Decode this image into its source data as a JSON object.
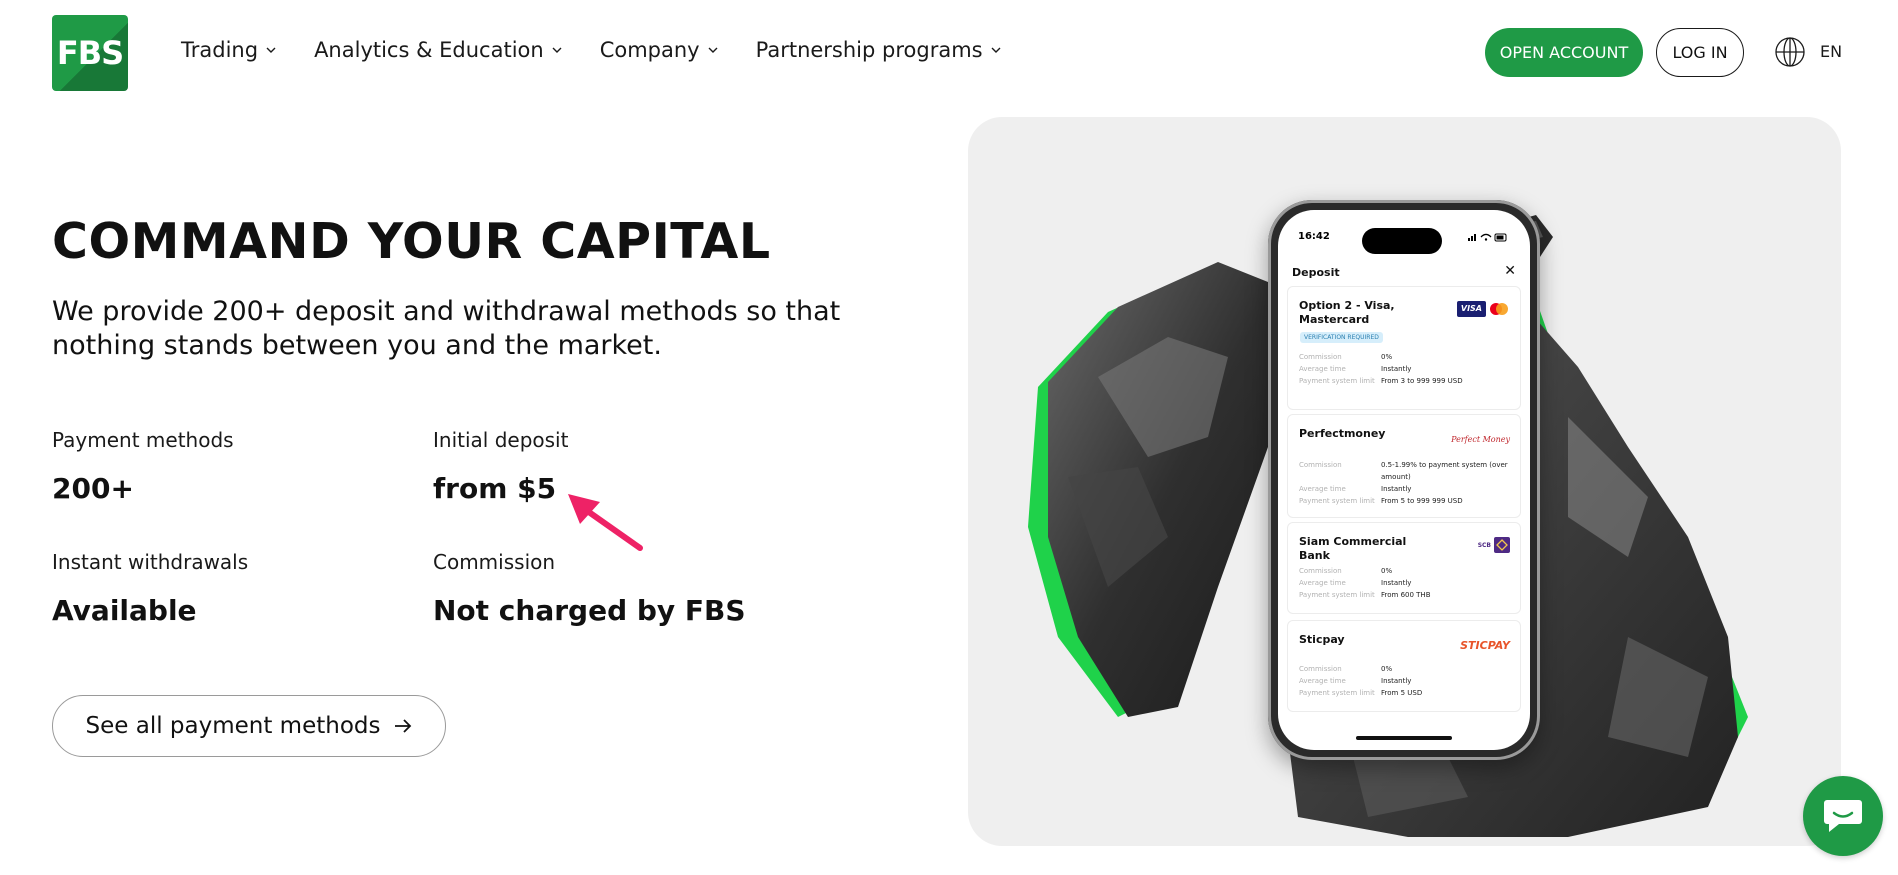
{
  "brand": {
    "logo_text": "FBS",
    "accent": "#1f9a46"
  },
  "nav": {
    "items": [
      {
        "label": "Trading"
      },
      {
        "label": "Analytics & Education"
      },
      {
        "label": "Company"
      },
      {
        "label": "Partnership programs"
      }
    ],
    "open_account": "OPEN ACCOUNT",
    "log_in": "LOG IN",
    "language": "EN"
  },
  "hero": {
    "title": "COMMAND YOUR CAPITAL",
    "subtitle": "We provide 200+ deposit and withdrawal methods so that nothing stands between you and the market."
  },
  "stats": [
    {
      "label": "Payment methods",
      "value": "200+"
    },
    {
      "label": "Initial deposit",
      "value": "from $5"
    },
    {
      "label": "Instant withdrawals",
      "value": "Available"
    },
    {
      "label": "Commission",
      "value": "Not charged by FBS"
    }
  ],
  "cta": {
    "label": "See all payment methods"
  },
  "phone": {
    "time": "16:42",
    "screen_title": "Deposit",
    "close": "✕",
    "methods": [
      {
        "name": "Option 2 - Visa, Mastercard",
        "badge": "VERIFICATION REQUIRED",
        "logo": "visa-mastercard",
        "visa_text": "VISA",
        "rows": [
          {
            "k": "Commission",
            "v": "0%"
          },
          {
            "k": "Average time",
            "v": "Instantly"
          },
          {
            "k": "Payment system limit",
            "v": "From 3 to 999 999 USD"
          }
        ]
      },
      {
        "name": "Perfectmoney",
        "logo": "perfect-money",
        "logo_text": "Perfect Money",
        "rows": [
          {
            "k": "Commission",
            "v": "0.5-1.99% to payment system (over amount)"
          },
          {
            "k": "Average time",
            "v": "Instantly"
          },
          {
            "k": "Payment system limit",
            "v": "From 5 to 999 999 USD"
          }
        ]
      },
      {
        "name": "Siam Commercial Bank",
        "logo": "scb",
        "logo_text": "SCB",
        "rows": [
          {
            "k": "Commission",
            "v": "0%"
          },
          {
            "k": "Average time",
            "v": "Instantly"
          },
          {
            "k": "Payment system limit",
            "v": "From 600 THB"
          }
        ]
      },
      {
        "name": "Sticpay",
        "logo": "sticpay",
        "logo_text": "STICPAY",
        "rows": [
          {
            "k": "Commission",
            "v": "0%"
          },
          {
            "k": "Average time",
            "v": "Instantly"
          },
          {
            "k": "Payment system limit",
            "v": "From 5 USD"
          }
        ]
      }
    ]
  },
  "chat": {
    "icon": "chat-bubble-icon"
  }
}
